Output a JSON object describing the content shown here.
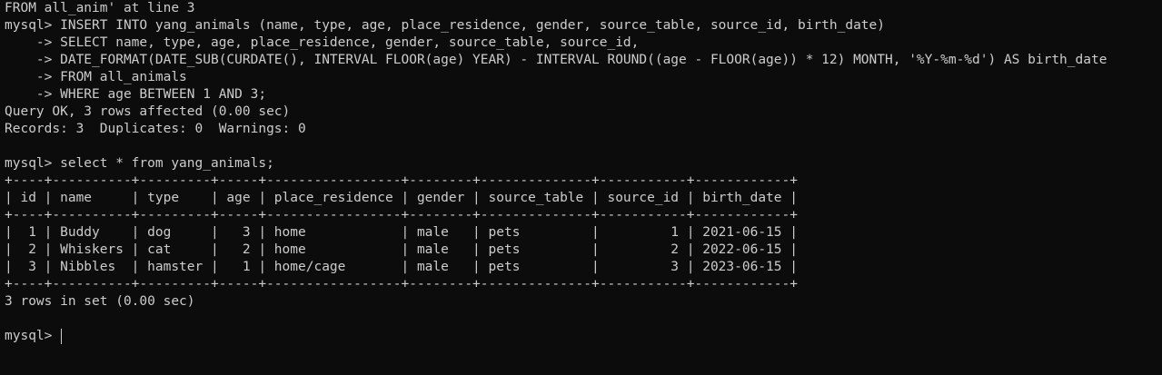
{
  "terminal": {
    "lines": [
      "FROM all_anim' at line 3",
      "mysql> INSERT INTO yang_animals (name, type, age, place_residence, gender, source_table, source_id, birth_date)",
      "    -> SELECT name, type, age, place_residence, gender, source_table, source_id,",
      "    -> DATE_FORMAT(DATE_SUB(CURDATE(), INTERVAL FLOOR(age) YEAR) - INTERVAL ROUND((age - FLOOR(age)) * 12) MONTH, '%Y-%m-%d') AS birth_date",
      "    -> FROM all_animals",
      "    -> WHERE age BETWEEN 1 AND 3;",
      "Query OK, 3 rows affected (0.00 sec)",
      "Records: 3  Duplicates: 0  Warnings: 0",
      "",
      "mysql> select * from yang_animals;",
      "+----+----------+---------+-----+-----------------+--------+--------------+-----------+------------+",
      "| id | name     | type    | age | place_residence | gender | source_table | source_id | birth_date |",
      "+----+----------+---------+-----+-----------------+--------+--------------+-----------+------------+",
      "|  1 | Buddy    | dog     |   3 | home            | male   | pets         |         1 | 2021-06-15 |",
      "|  2 | Whiskers | cat     |   2 | home            | male   | pets         |         2 | 2022-06-15 |",
      "|  3 | Nibbles  | hamster |   1 | home/cage       | male   | pets         |         3 | 2023-06-15 |",
      "+----+----------+---------+-----+-----------------+--------+--------------+-----------+------------+",
      "3 rows in set (0.00 sec)",
      ""
    ],
    "prompt": "mysql> "
  }
}
